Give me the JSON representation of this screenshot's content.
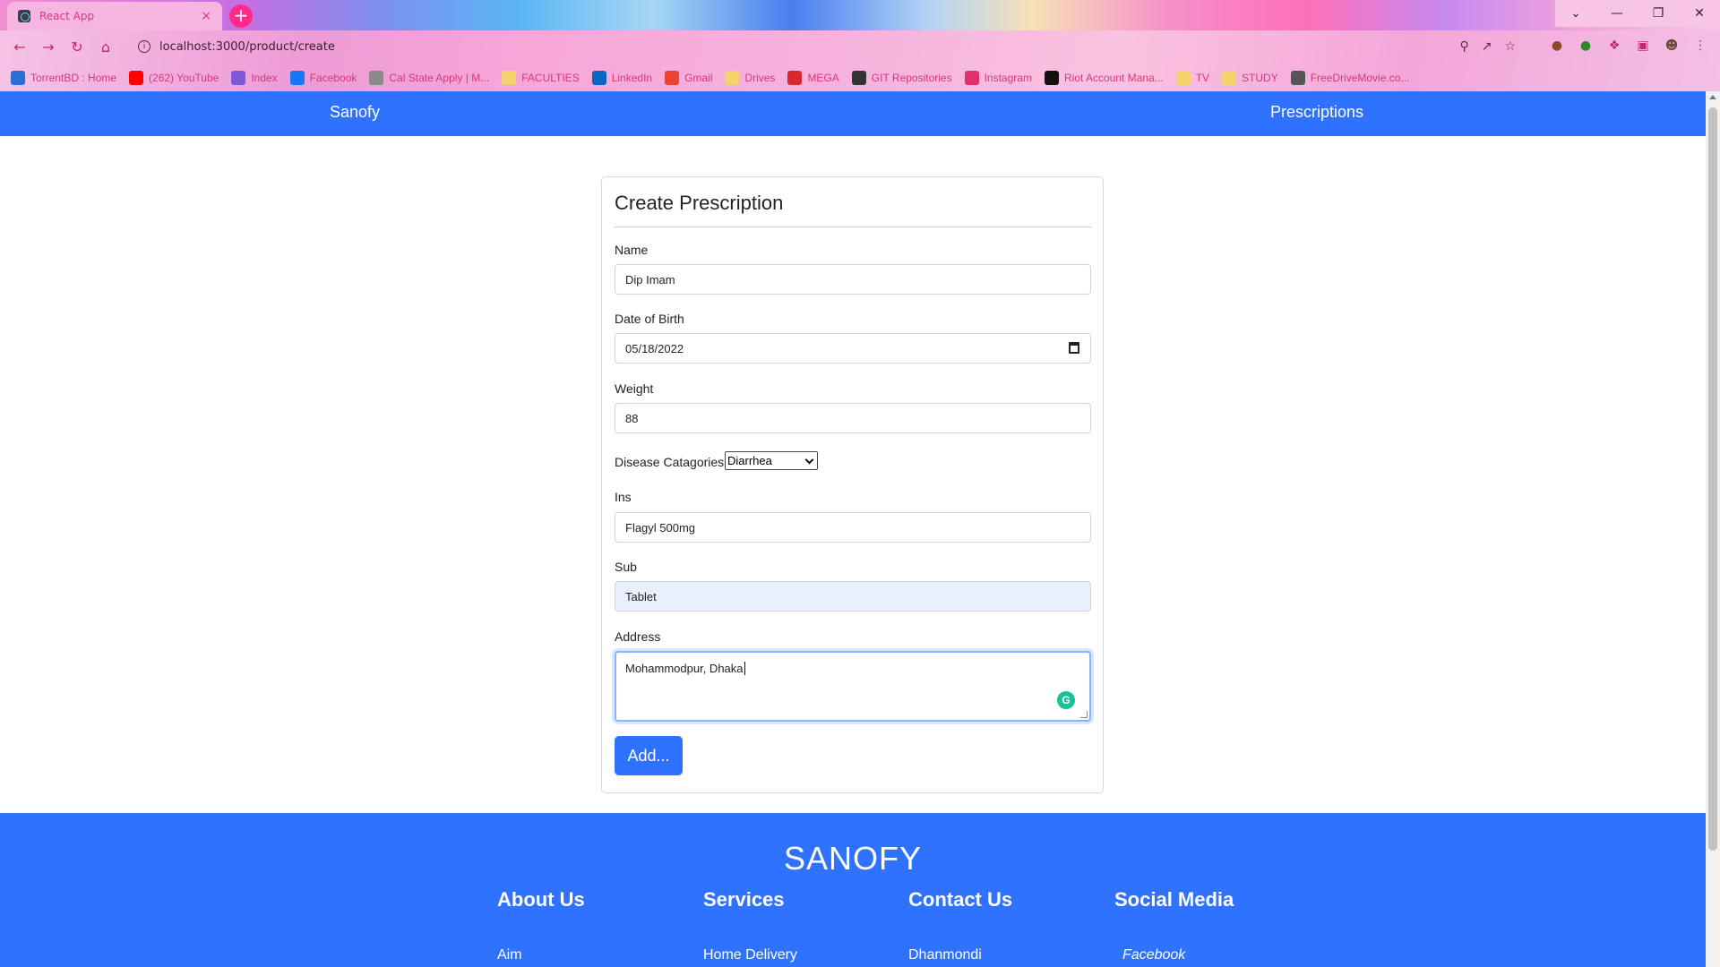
{
  "browser": {
    "tab_title": "React App",
    "tab_close": "×",
    "new_tab": "+",
    "url": "localhost:3000/product/create",
    "window_controls": [
      "⌄",
      "—",
      "❐",
      "✕"
    ],
    "bookmarks": [
      {
        "label": "TorrentBD : Home",
        "color": "#2a6fd6"
      },
      {
        "label": "(262) YouTube",
        "color": "#ff0000"
      },
      {
        "label": "Index",
        "color": "#7a5ad6"
      },
      {
        "label": "Facebook",
        "color": "#1877f2"
      },
      {
        "label": "Cal State Apply | M...",
        "color": "#8a8a8a"
      },
      {
        "label": "FACULTIES",
        "color": "#f5d36b"
      },
      {
        "label": "LinkedIn",
        "color": "#0a66c2"
      },
      {
        "label": "Gmail",
        "color": "#ea4335"
      },
      {
        "label": "Drives",
        "color": "#f5d36b"
      },
      {
        "label": "MEGA",
        "color": "#d9272e"
      },
      {
        "label": "GIT Repositories",
        "color": "#333333"
      },
      {
        "label": "Instagram",
        "color": "#e1306c"
      },
      {
        "label": "Riot Account Mana...",
        "color": "#111111"
      },
      {
        "label": "TV",
        "color": "#f5d36b"
      },
      {
        "label": "STUDY",
        "color": "#f5d36b"
      },
      {
        "label": "FreeDriveMovie.co...",
        "color": "#555555"
      }
    ]
  },
  "navbar": {
    "brand": "Sanofy",
    "link": "Prescriptions"
  },
  "form": {
    "title": "Create Prescription",
    "name_label": "Name",
    "name_value": "Dip Imam",
    "dob_label": "Date of Birth",
    "dob_value": "05/18/2022",
    "weight_label": "Weight",
    "weight_value": "88",
    "disease_label": "Disease Catagories:",
    "disease_value": "Diarrhea",
    "ins_label": "Ins",
    "ins_value": "Flagyl 500mg",
    "sub_label": "Sub",
    "sub_value": "Tablet",
    "address_label": "Address",
    "address_value": "Mohammodpur, Dhaka",
    "submit_label": "Add..."
  },
  "footer": {
    "brand": "SANOFY",
    "columns": [
      {
        "heading": "About Us",
        "first_item": "Aim"
      },
      {
        "heading": "Services",
        "first_item": "Home Delivery"
      },
      {
        "heading": "Contact Us",
        "first_item": "Dhanmondi"
      },
      {
        "heading": "Social Media",
        "first_item": "Facebook"
      }
    ]
  },
  "colors": {
    "primary": "#2f72ff",
    "grammarly": "#15c39a"
  }
}
